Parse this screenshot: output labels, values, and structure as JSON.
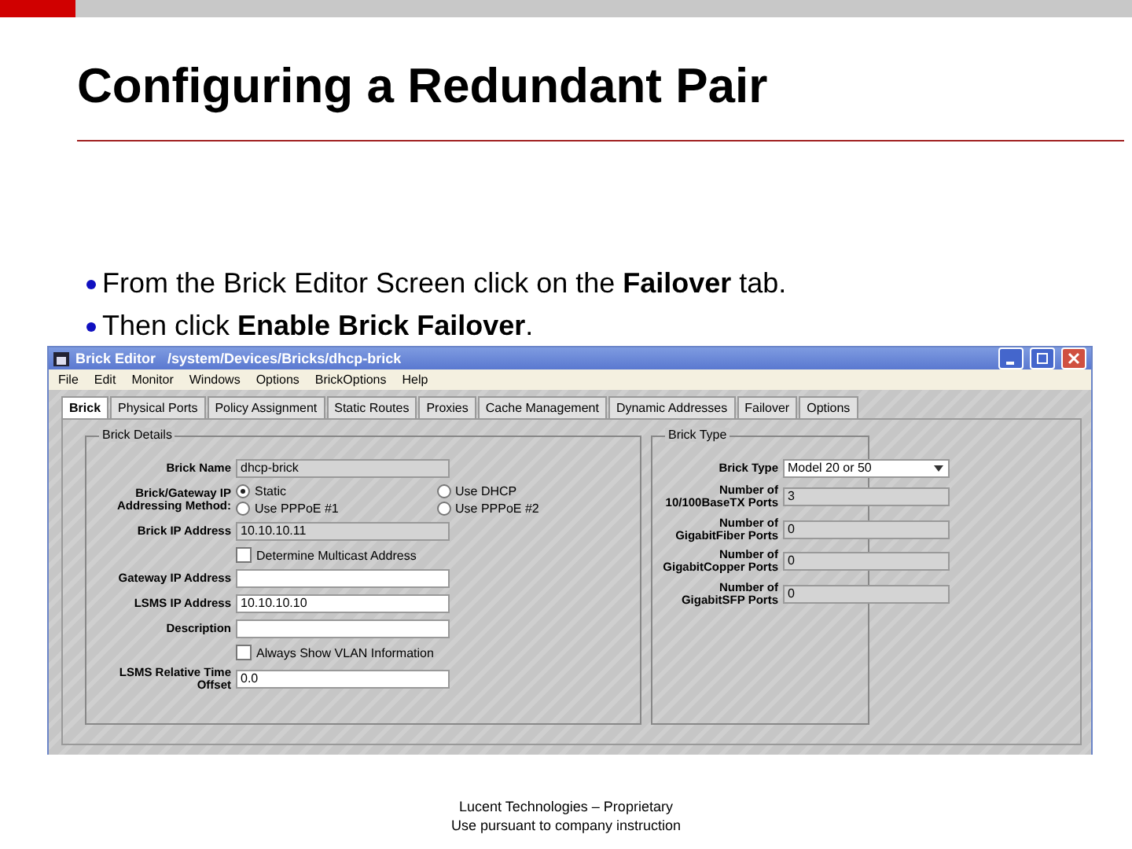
{
  "slide": {
    "title": "Configuring a Redundant Pair",
    "bullets": [
      "From the Brick Editor Screen click on the **Failover** tab.",
      "Then click **Enable Brick Failover**."
    ],
    "footer_lines": [
      "Lucent Technologies – Proprietary",
      "Use pursuant to company instruction"
    ]
  },
  "window": {
    "title": "Brick Editor   /system/Devices/Bricks/dhcp-brick",
    "menu": [
      "File",
      "Edit",
      "Monitor",
      "Windows",
      "Options",
      "BrickOptions",
      "Help"
    ],
    "tabs": [
      {
        "label": "Brick",
        "selected": true
      },
      {
        "label": "Physical Ports",
        "selected": false
      },
      {
        "label": "Policy Assignment",
        "selected": false
      },
      {
        "label": "Static Routes",
        "selected": false
      },
      {
        "label": "Proxies",
        "selected": false
      },
      {
        "label": "Cache Management",
        "selected": false
      },
      {
        "label": "Dynamic Addresses",
        "selected": false
      },
      {
        "label": "Failover",
        "selected": false
      },
      {
        "label": "Options",
        "selected": false
      }
    ],
    "groups": [
      {
        "title": "Brick Details",
        "rows": [
          {
            "kind": "field",
            "label": "Brick Name",
            "value": "dhcp-brick",
            "disabled": true
          },
          {
            "kind": "radios",
            "label": "Brick/Gateway IP Addressing Method:",
            "options": [
              {
                "label": "Static",
                "selected": true
              },
              {
                "label": "Use DHCP",
                "selected": false
              },
              {
                "label": "Use PPPoE #1",
                "selected": false
              },
              {
                "label": "Use PPPoE #2",
                "selected": false
              }
            ]
          },
          {
            "kind": "field",
            "label": "Brick IP Address",
            "value": "10.10.10.11",
            "disabled": true
          },
          {
            "kind": "checkbox",
            "label": "Determine Multicast Address",
            "checked": false
          },
          {
            "kind": "field",
            "label": "Gateway IP Address",
            "disabled": false
          },
          {
            "kind": "field",
            "label": "LSMS IP Address",
            "value": "10.10.10.10",
            "disabled": false
          },
          {
            "kind": "field",
            "label": "Description",
            "disabled": false
          },
          {
            "kind": "checkbox",
            "label": "Always Show VLAN Information",
            "checked": false
          },
          {
            "kind": "field",
            "label": "LSMS Relative Time Offset",
            "value": "0.0",
            "disabled": false
          }
        ]
      },
      {
        "title": "Brick Type",
        "rows": [
          {
            "kind": "dropdown",
            "label": "Brick Type",
            "value": "Model 20 or 50"
          },
          {
            "kind": "field",
            "label": "Number of 10/100BaseTX Ports",
            "value": "3",
            "disabled": true
          },
          {
            "kind": "field",
            "label": "Number of GigabitFiber Ports",
            "value": "0",
            "disabled": true
          },
          {
            "kind": "field",
            "label": "Number of GigabitCopper Ports",
            "value": "0",
            "disabled": true
          },
          {
            "kind": "field",
            "label": "Number of GigabitSFP Ports",
            "value": "0",
            "disabled": true
          }
        ]
      }
    ]
  }
}
